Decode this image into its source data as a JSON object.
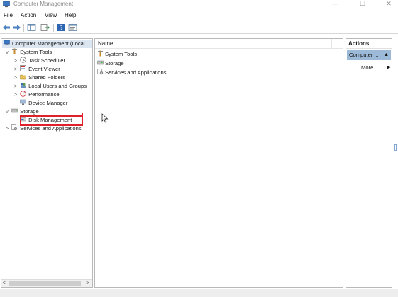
{
  "window": {
    "title": "Computer Management",
    "minimize_label": "—",
    "maximize_label": "☐",
    "close_label": "✕"
  },
  "menu": {
    "items": [
      "File",
      "Action",
      "View",
      "Help"
    ]
  },
  "tree": {
    "root": "Computer Management (Local",
    "items": [
      {
        "label": "System Tools",
        "expander": "v"
      },
      {
        "label": "Task Scheduler",
        "expander": ">"
      },
      {
        "label": "Event Viewer",
        "expander": ">"
      },
      {
        "label": "Shared Folders",
        "expander": ">"
      },
      {
        "label": "Local Users and Groups",
        "expander": ">"
      },
      {
        "label": "Performance",
        "expander": ">"
      },
      {
        "label": "Device Manager",
        "expander": ""
      },
      {
        "label": "Storage",
        "expander": "v"
      },
      {
        "label": "Disk Management",
        "expander": ""
      },
      {
        "label": "Services and Applications",
        "expander": ">"
      }
    ]
  },
  "center": {
    "column_name": "Name",
    "items": [
      "System Tools",
      "Storage",
      "Services and Applications"
    ]
  },
  "actions": {
    "header": "Actions",
    "section": "Computer ...",
    "section_arrow": "▲",
    "more": "More ...",
    "more_arrow": "▶"
  },
  "scroll": {
    "left_arrow": "<",
    "right_arrow": ">"
  },
  "colors": {
    "accent_selection": "#9cb9d8",
    "highlight_box": "#e0202a"
  }
}
